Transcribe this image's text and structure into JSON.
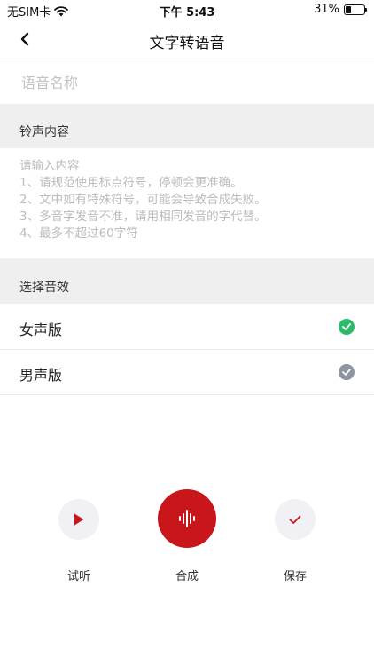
{
  "status_bar": {
    "carrier": "无SIM卡",
    "time": "下午 5:43",
    "battery_percent": "31%",
    "battery_level": 0.31
  },
  "nav": {
    "title": "文字转语音"
  },
  "name_field": {
    "placeholder": "语音名称",
    "value": ""
  },
  "ringtone_section": {
    "label": "铃声内容"
  },
  "content_field": {
    "placeholder": "请输入内容\n1、请规范使用标点符号，停顿会更准确。\n2、文中如有特殊符号，可能会导致合成失败。\n3、多音字发音不准，请用相同发音的字代替。\n4、最多不超过60字符",
    "value": ""
  },
  "effect_section": {
    "label": "选择音效"
  },
  "effects": [
    {
      "label": "女声版",
      "selected": true,
      "check_color": "#2dbb6a"
    },
    {
      "label": "男声版",
      "selected": false,
      "check_color": "#8e94a0"
    }
  ],
  "actions": {
    "preview_label": "试听",
    "synthesize_label": "合成",
    "save_label": "保存"
  },
  "colors": {
    "accent": "#c9161b",
    "secondary_button_bg": "#f0f0f5",
    "section_bg": "#efefef"
  }
}
